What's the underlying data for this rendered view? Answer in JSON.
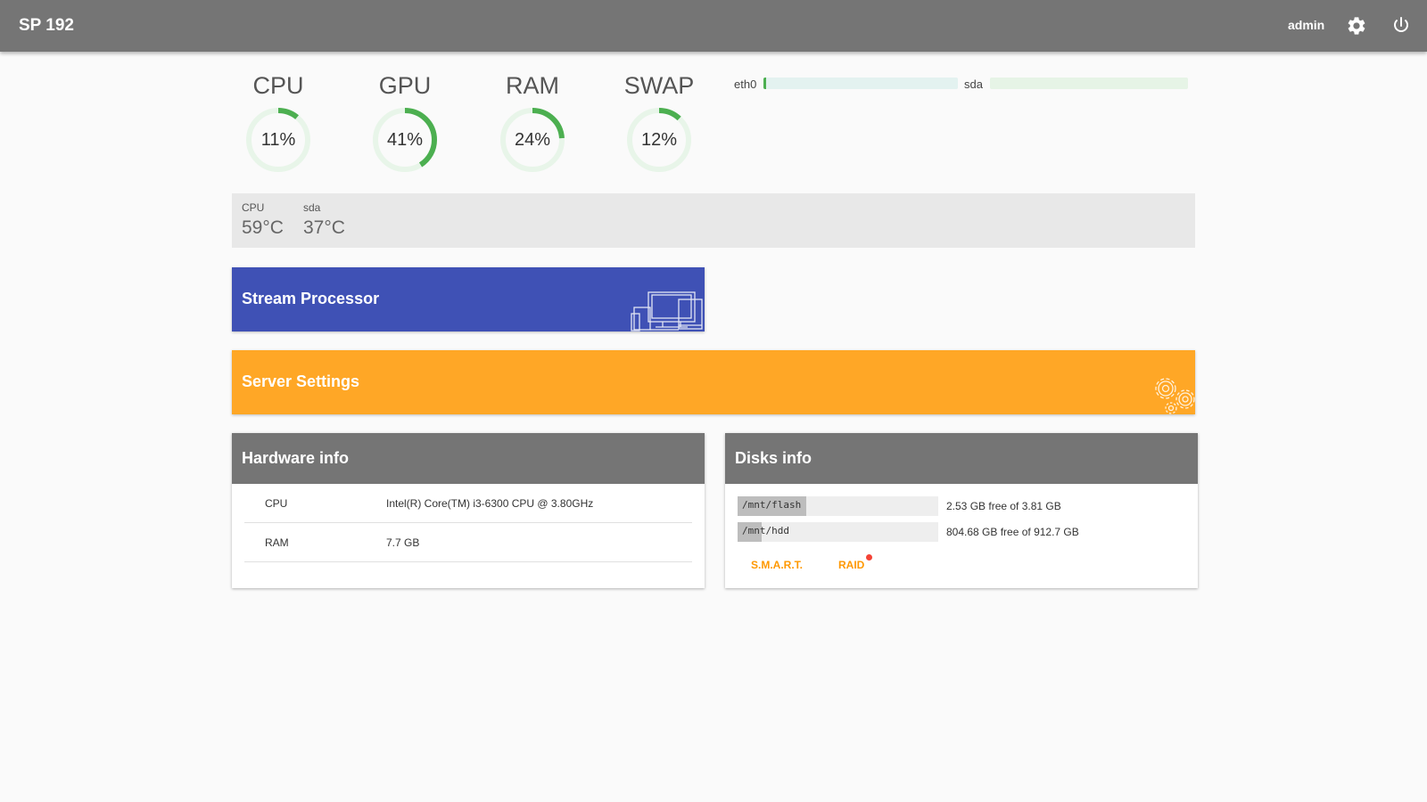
{
  "header": {
    "title": "SP 192",
    "user": "admin",
    "settings_icon": "gear-icon",
    "power_icon": "power-icon"
  },
  "gauges": [
    {
      "label": "CPU",
      "value": 11,
      "display": "11%"
    },
    {
      "label": "GPU",
      "value": 41,
      "display": "41%"
    },
    {
      "label": "RAM",
      "value": 24,
      "display": "24%"
    },
    {
      "label": "SWAP",
      "value": 12,
      "display": "12%"
    }
  ],
  "network": [
    {
      "label": "eth0",
      "usage_percent": 1.5
    },
    {
      "label": "sda",
      "usage_percent": 0
    }
  ],
  "temperatures": [
    {
      "label": "CPU",
      "value": "59°C"
    },
    {
      "label": "sda",
      "value": "37°C"
    }
  ],
  "tiles": {
    "stream_processor": "Stream Processor",
    "server_settings": "Server Settings"
  },
  "hardware": {
    "title": "Hardware info",
    "rows": [
      {
        "key": "CPU",
        "value": "Intel(R) Core(TM) i3-6300 CPU @ 3.80GHz"
      },
      {
        "key": "RAM",
        "value": "7.7 GB"
      }
    ]
  },
  "disks": {
    "title": "Disks info",
    "items": [
      {
        "mount": "/mnt/flash",
        "info": "2.53 GB free of 3.81 GB",
        "used_percent": 34
      },
      {
        "mount": "/mnt/hdd",
        "info": "804.68 GB free of 912.7 GB",
        "used_percent": 12
      }
    ],
    "smart_label": "S.M.A.R.T.",
    "raid_label": "RAID"
  },
  "colors": {
    "topbar": "#757575",
    "accent_green": "#4caf50",
    "stream_tile": "#3f51b5",
    "server_tile": "#ffa726",
    "link_orange": "#ff9800",
    "alert_red": "#f44336"
  }
}
